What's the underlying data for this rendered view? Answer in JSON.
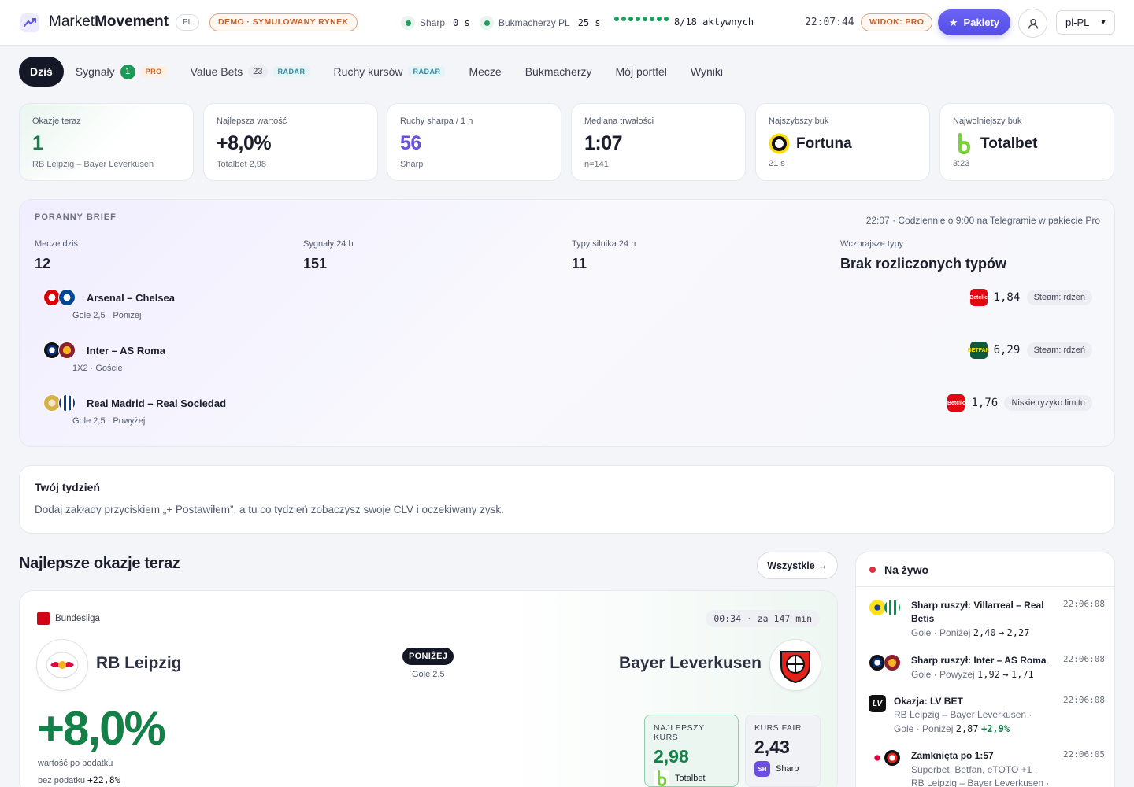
{
  "header": {
    "brand_prefix": "Market",
    "brand_bold": "Movement",
    "country_badge": "PL",
    "demo_badge": "DEMO · SYMULOWANY RYNEK",
    "sharp_label": "Sharp",
    "sharp_value": "0 s",
    "bookmakers_label": "Bukmacherzy PL",
    "bookmakers_value": "25 s",
    "active_label": "8/18 aktywnych",
    "clock": "22:07:44",
    "view_badge": "WIDOK: PRO",
    "packets_button": "Pakiety",
    "language": "pl-PL",
    "accent_color": "#5b54ee"
  },
  "nav": {
    "today": "Dziś",
    "signals": "Sygnały",
    "signals_count": "1",
    "signals_tag": "PRO",
    "value_bets": "Value Bets",
    "value_bets_count": "23",
    "value_bets_tag": "RADAR",
    "odds_moves": "Ruchy kursów",
    "odds_moves_tag": "RADAR",
    "matches": "Mecze",
    "bookmakers": "Bukmacherzy",
    "portfolio": "Mój portfel",
    "results": "Wyniki"
  },
  "kpis": [
    {
      "label": "Okazje teraz",
      "value": "1",
      "sub": "RB Leipzig – Bayer Leverkusen"
    },
    {
      "label": "Najlepsza wartość",
      "value": "+8,0%",
      "sub": "Totalbet 2,98"
    },
    {
      "label": "Ruchy sharpa / 1 h",
      "value": "56",
      "sub": "Sharp"
    },
    {
      "label": "Mediana trwałości",
      "value": "1:07",
      "sub": "n=141"
    },
    {
      "label": "Najszybszy buk",
      "value": "Fortuna",
      "sub": "21 s",
      "icon": "fortuna-logo-icon"
    },
    {
      "label": "Najwolniejszy buk",
      "value": "Totalbet",
      "sub": "3:23",
      "icon": "totalbet-logo-icon"
    }
  ],
  "brief": {
    "title": "PORANNY BRIEF",
    "meta": "22:07 · Codziennie o 9:00 na Telegramie w pakiecie Pro",
    "stats": [
      {
        "label": "Mecze dziś",
        "value": "12"
      },
      {
        "label": "Sygnały 24 h",
        "value": "151"
      },
      {
        "label": "Typy silnika 24 h",
        "value": "11"
      },
      {
        "label": "Wczorajsze typy",
        "value": "Brak rozliczonych typów"
      }
    ],
    "rows": [
      {
        "match": "Arsenal – Chelsea",
        "sub": "Gole 2,5 · Poniżej",
        "bookmaker": "Betclic",
        "odds": "1,84",
        "tag": "Steam: rdzeń"
      },
      {
        "match": "Inter – AS Roma",
        "sub": "1X2 · Goście",
        "bookmaker": "BETFAN",
        "odds": "6,29",
        "tag": "Steam: rdzeń"
      },
      {
        "match": "Real Madrid – Real Sociedad",
        "sub": "Gole 2,5 · Powyżej",
        "bookmaker": "Betclic",
        "odds": "1,76",
        "tag": "Niskie ryzyko limitu"
      }
    ]
  },
  "week": {
    "title": "Twój tydzień",
    "text": "Dodaj zakłady przyciskiem „+ Postawiłem”, a tu co tydzień zobaczysz swoje CLV i oczekiwany zysk."
  },
  "best": {
    "title": "Najlepsze okazje teraz",
    "all_button": "Wszystkie →",
    "league": "Bundesliga",
    "timer": "00:34 · za 147 min",
    "home": "RB Leipzig",
    "away": "Bayer Leverkusen",
    "market_pill": "PONIŻEJ",
    "market_sub": "Gole 2,5",
    "value": "+8,0%",
    "after_tax_label": "wartość po podatku",
    "no_tax_label": "bez podatku",
    "no_tax_value": "+22,8%",
    "best_odds_label": "NAJLEPSZY KURS",
    "best_odds_value": "2,98",
    "best_odds_book": "Totalbet",
    "fair_label": "KURS FAIR",
    "fair_value": "2,43",
    "fair_book": "Sharp",
    "fair_book_badge": "SH",
    "value_color": "#138047"
  },
  "live": {
    "title": "Na żywo",
    "items": [
      {
        "title": "Sharp ruszył: Villarreal – Real Betis",
        "time": "22:06:08",
        "market": "Gole · Poniżej",
        "from": "2,40",
        "to": "2,27"
      },
      {
        "title": "Sharp ruszył: Inter – AS Roma",
        "time": "22:06:08",
        "market": "Gole · Powyżej",
        "from": "1,92",
        "to": "1,71"
      },
      {
        "title": "Okazja: LV BET",
        "time": "22:06:08",
        "line1": "RB Leipzig – Bayer Leverkusen ·",
        "market": "Gole · Poniżej",
        "odds": "2,87",
        "plus": "+2,9%"
      },
      {
        "title": "Zamknięta po 1:57",
        "time": "22:06:05",
        "line1": "Superbet, Betfan, eTOTO +1 ·",
        "line2": "RB Leipzig – Bayer Leverkusen ·"
      }
    ]
  }
}
